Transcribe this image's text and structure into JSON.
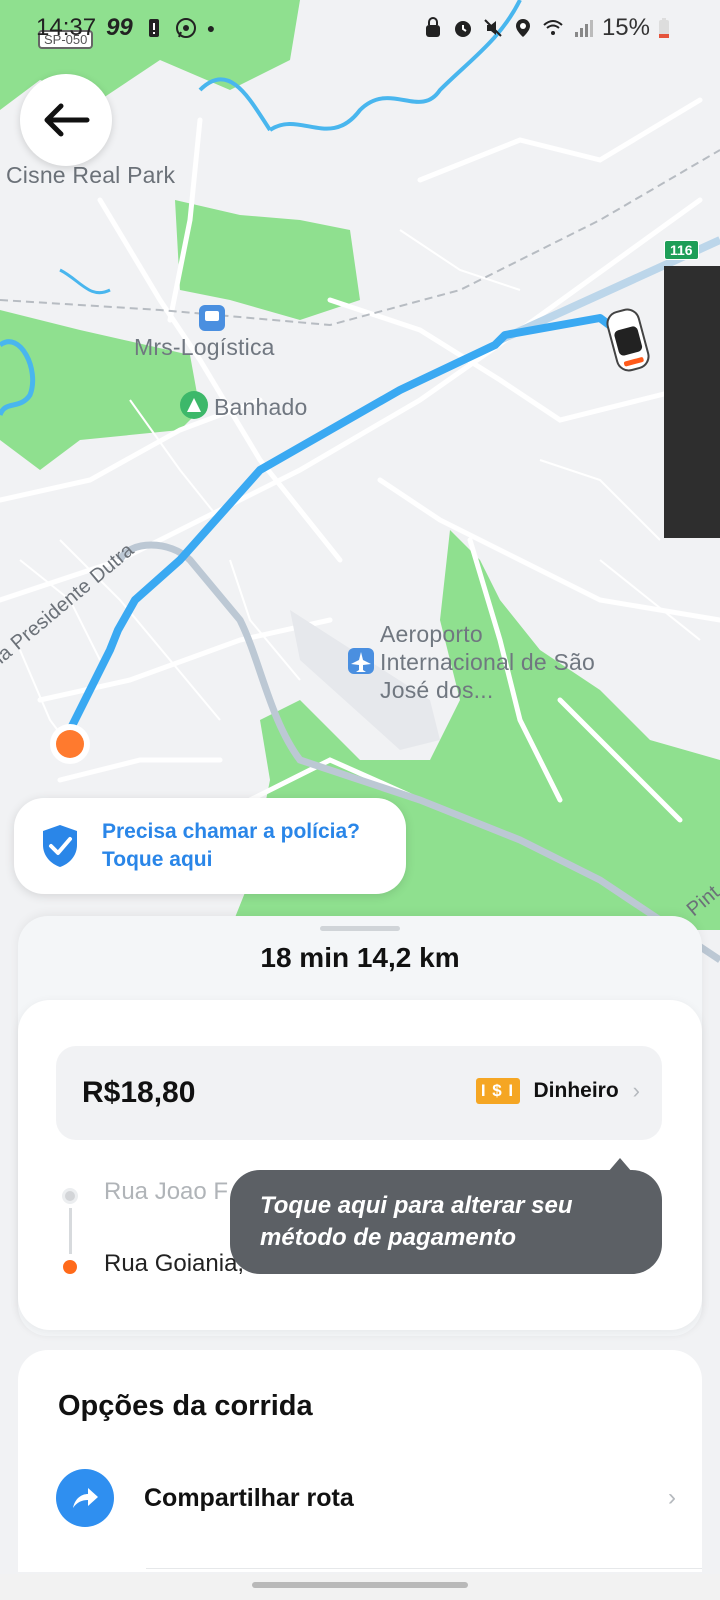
{
  "status_bar": {
    "time": "14:37",
    "notification_count": "99",
    "battery": "15%"
  },
  "map": {
    "labels": {
      "cisne": "Cisne Real Park",
      "mrs": "Mrs-Logística",
      "banhado": "Banhado",
      "airport_1": "Aeroporto",
      "airport_2": "Internacional de São",
      "airport_3": "José dos...",
      "road_dutra": "Via Presidente Dutra",
      "road_pint": "Pint",
      "sp_shield": "SP-050",
      "hwy_shield": "116"
    },
    "colors": {
      "route": "#3aa9f2",
      "park": "#8fe08f",
      "water": "#49b6ee"
    }
  },
  "back_button": {
    "icon": "arrow-left-icon"
  },
  "police_card": {
    "line1": "Precisa chamar a polícia?",
    "line2": "Toque aqui"
  },
  "trip": {
    "summary": "18 min  14,2 km",
    "price": "R$18,80",
    "payment_icon_text": "I $ I",
    "payment_method": "Dinheiro",
    "origin": "Rua Joao F",
    "destination": "Rua Goiania,"
  },
  "tooltip": {
    "text": "Toque aqui para alterar seu método de pagamento"
  },
  "options": {
    "title": "Opções da corrida",
    "share_label": "Compartilhar rota"
  }
}
